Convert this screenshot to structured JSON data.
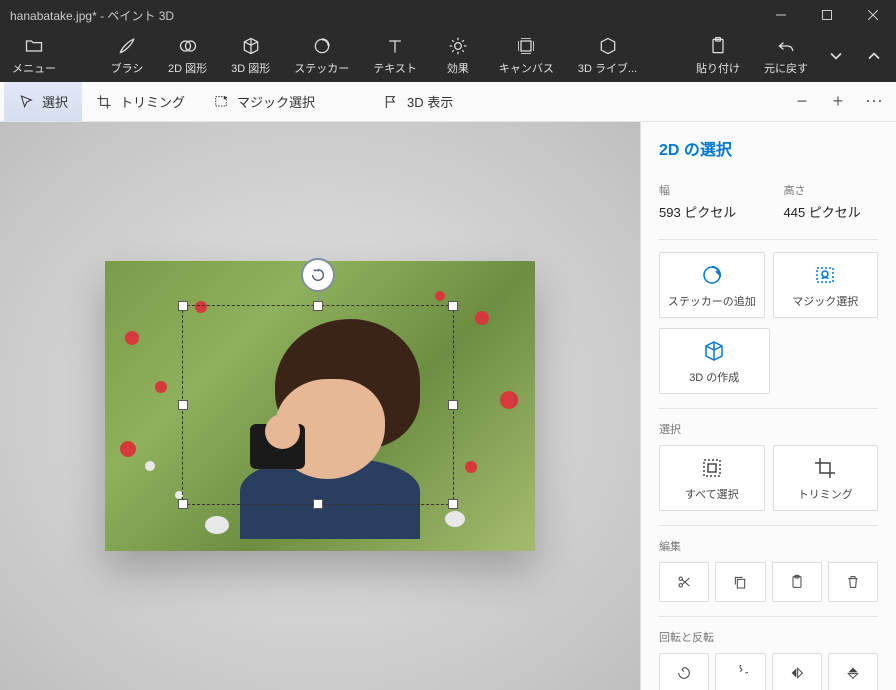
{
  "title": "hanabatake.jpg* - ペイント 3D",
  "ribbon": {
    "menu": "メニュー",
    "brush": "ブラシ",
    "shapes2d": "2D 図形",
    "shapes3d": "3D 図形",
    "sticker": "ステッカー",
    "text": "テキスト",
    "effect": "効果",
    "canvas": "キャンバス",
    "lib3d": "3D ライブ...",
    "paste": "貼り付け",
    "undo": "元に戻す"
  },
  "toolbar": {
    "select": "選択",
    "trim": "トリミング",
    "magic": "マジック選択",
    "view3d": "3D 表示"
  },
  "panel": {
    "title": "2D の選択",
    "width_label": "幅",
    "width_value": "593 ピクセル",
    "height_label": "高さ",
    "height_value": "445 ピクセル",
    "add_sticker": "ステッカーの追加",
    "magic_select": "マジック選択",
    "make3d": "3D の作成",
    "select_section": "選択",
    "select_all": "すべて選択",
    "trim_btn": "トリミング",
    "edit_section": "編集",
    "rotate_section": "回転と反転"
  }
}
